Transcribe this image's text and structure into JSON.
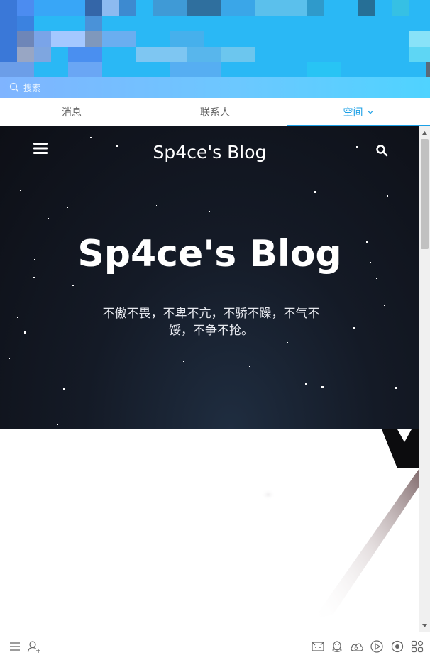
{
  "search": {
    "placeholder": "搜索"
  },
  "tabs": [
    {
      "label": "消息",
      "active": false
    },
    {
      "label": "联系人",
      "active": false
    },
    {
      "label": "空间",
      "active": true
    }
  ],
  "blog": {
    "nav_title": "Sp4ce's Blog",
    "hero_title": "Sp4ce's Blog",
    "hero_subtitle": "不傲不畏，不卑不亢，不骄不躁，不气不馁，不争不抢。"
  },
  "icons": {
    "search": "search-icon",
    "chevron": "chevron-down-icon",
    "menu": "hamburger-menu-icon",
    "blog_search": "search-icon",
    "toolbar_left": [
      "menu-lines-icon",
      "add-contact-icon"
    ],
    "toolbar_right": [
      "game-icon",
      "penguin-icon",
      "weiyun-cloud-icon",
      "video-play-icon",
      "qq-browser-icon",
      "apps-grid-icon"
    ]
  },
  "colors": {
    "accent": "#1ca0e6",
    "banner": "#2ab8f5",
    "hero_bg": "#141a26"
  }
}
